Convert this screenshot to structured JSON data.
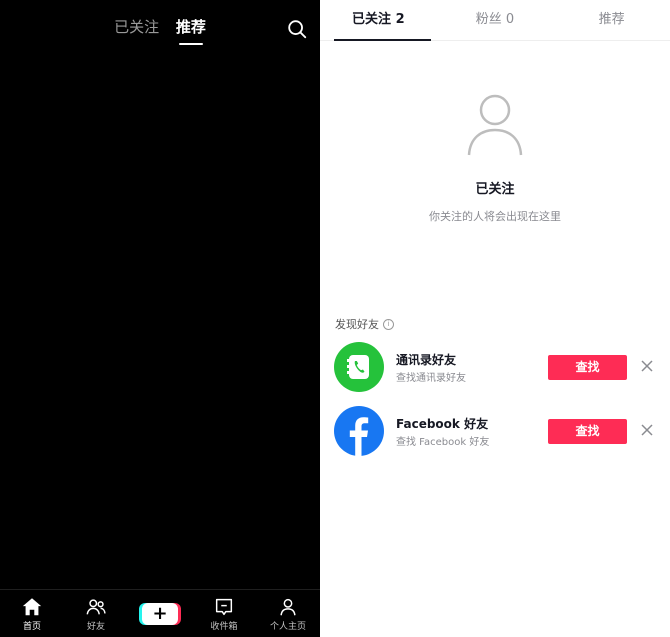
{
  "feed": {
    "tabs": [
      {
        "label": "已关注",
        "active": false
      },
      {
        "label": "推荐",
        "active": true
      }
    ],
    "search_icon": "search-icon"
  },
  "tabbar": {
    "items": [
      {
        "label": "首页",
        "icon": "home-icon",
        "active": true
      },
      {
        "label": "好友",
        "icon": "friends-icon",
        "active": false
      },
      {
        "label": "",
        "icon": "plus-icon",
        "active": false
      },
      {
        "label": "收件箱",
        "icon": "inbox-icon",
        "active": false
      },
      {
        "label": "个人主页",
        "icon": "profile-icon",
        "active": false
      }
    ],
    "create_symbol": "+"
  },
  "following": {
    "tabs": [
      {
        "label": "已关注 2",
        "active": true
      },
      {
        "label": "粉丝 0",
        "active": false
      },
      {
        "label": "推荐",
        "active": false
      }
    ],
    "empty_title": "已关注",
    "empty_subtitle": "你关注的人将会出现在这里",
    "discover_title": "发现好友",
    "discover_info": "i",
    "friends": [
      {
        "name": "通讯录好友",
        "sub": "查找通讯录好友",
        "button": "查找",
        "icon": "contacts-icon",
        "color": "#25c23b"
      },
      {
        "name": "Facebook 好友",
        "sub": "查找 Facebook 好友",
        "button": "查找",
        "icon": "facebook-icon",
        "color": "#1877f2"
      }
    ]
  },
  "colors": {
    "accent": "#fe2c55",
    "plus_cyan": "#25f4ee",
    "feed_bg": "#000000"
  }
}
